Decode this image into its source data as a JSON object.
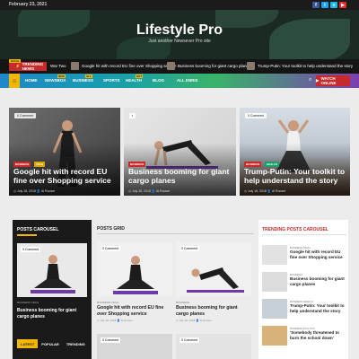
{
  "topbar": {
    "date": "February 23, 2021",
    "social": [
      {
        "icon": "facebook-icon",
        "glyph": "f",
        "color": "#3b5998"
      },
      {
        "icon": "twitter-icon",
        "glyph": "t",
        "color": "#1da1f2"
      },
      {
        "icon": "vimeo-icon",
        "glyph": "v",
        "color": "#1ab7ea"
      },
      {
        "icon": "youtube-icon",
        "glyph": "▶",
        "color": "#e52d27"
      }
    ]
  },
  "header": {
    "site_title": "Lifestyle Pro",
    "tagline": "Just another Newsever Pro site"
  },
  "ticker": {
    "online": "Online",
    "label": "TRENDING NEWS",
    "items": [
      "War Two",
      "Google hit with record EU fine over Shopping service",
      "Business booming for giant cargo planes",
      "Trump-Putin: Your toolkit to help understand the story"
    ]
  },
  "nav": {
    "items": [
      "HOME",
      "NEWSBOX",
      "BUSINESS",
      "SPORTS",
      "HEALTH",
      "BLOG",
      "ALL ENRIX"
    ],
    "badges": [
      "NEW",
      "ALL",
      "HOT"
    ],
    "watch_label": "WATCH ONLINE",
    "colors": {
      "home": "#f2b705",
      "watch": "#c62a2a"
    }
  },
  "hero": [
    {
      "comment": "0 Comment",
      "categories": [
        "BUSINESS",
        "TECH"
      ],
      "title": "Google hit with record EU fine over Shopping service",
      "meta": "◷ July 18, 2018  👤 Al Rooser"
    },
    {
      "comment": "0 Comment",
      "categories": [
        "BUSINESS"
      ],
      "title": "Business booming for giant cargo planes",
      "meta": "◷ July 18, 2018  👤 Al Rooser"
    },
    {
      "comment": "0 Comment",
      "categories": [
        "BUSINESS",
        "HEALTH"
      ],
      "title": "Trump-Putin: Your toolkit to help understand the story",
      "meta": "◷ July 18, 2018  👤 Al Rooser"
    }
  ],
  "carousel": {
    "heading": "POSTS CAROUSEL",
    "comment": "0 Comment",
    "categories": "BUSINESS   TECH",
    "title": "Business booming for giant cargo planes",
    "tabs": [
      "LATEST",
      "POPULAR",
      "TRENDING"
    ]
  },
  "grid": {
    "heading": "POSTS GRID",
    "cards": [
      {
        "comment": "0 Comment",
        "categories": "BUSINESS   TECH",
        "title": "Google hit with record EU fine over Shopping service",
        "meta": "◷ July 18, 2018  👤 Al Rooser"
      },
      {
        "comment": "0 Comment",
        "categories": "BUSINESS",
        "title": "Business booming for giant cargo planes",
        "meta": "◷ July 18, 2018  👤 Al Rooser"
      },
      {
        "comment": "0 Comment"
      },
      {
        "comment": "0 Comment"
      }
    ]
  },
  "trending": {
    "heading": "TRENDING POSTS CAROUSEL",
    "rows": [
      {
        "categories": "BUSINESS   TECH",
        "title": "Google hit with record EU fine over Shopping service",
        "meta": "◷ July 18, 2018"
      },
      {
        "categories": "BUSINESS",
        "title": "Business booming for giant cargo planes",
        "meta": "◷ July 18, 2018"
      },
      {
        "categories": "BUSINESS   HEALTH",
        "title": "Trump-Putin: Your toolkit to help understand the story",
        "meta": "◷ July 18, 2018"
      },
      {
        "categories": "BUSINESS   POLITICS",
        "title": "'Somebody threatened to burn the school down'",
        "meta": "◷ July 18, 2018"
      }
    ]
  }
}
